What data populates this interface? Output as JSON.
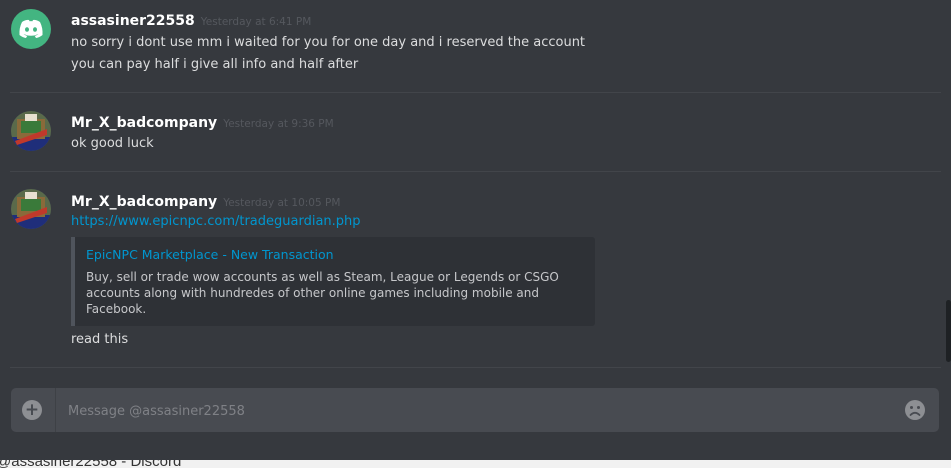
{
  "messages": [
    {
      "username": "assasiner22558",
      "timestamp": "Yesterday at 6:41 PM",
      "avatar_icon": "discord-logo-icon",
      "lines": [
        "no sorry i dont use mm i waited for you for one day and i reserved the account",
        "you can pay half i give all info and half after"
      ]
    },
    {
      "username": "Mr_X_badcompany",
      "timestamp": "Yesterday at 9:36 PM",
      "avatar_icon": "user-avatar",
      "lines": [
        "ok good luck"
      ]
    },
    {
      "username": "Mr_X_badcompany",
      "timestamp": "Yesterday at 10:05 PM",
      "avatar_icon": "user-avatar",
      "link": "https://www.epicnpc.com/tradeguardian.php",
      "embed": {
        "title": "EpicNPC Marketplace - New Transaction",
        "description": [
          "Buy, sell or trade wow accounts as well as Steam, League or Legends or CSGO",
          "accounts along with hundredes of other online games including mobile and",
          "Facebook."
        ]
      },
      "after_text": "read this"
    }
  ],
  "composer": {
    "placeholder": "Message @assasiner22558",
    "attach_icon": "plus-circle-icon",
    "emoji_icon": "sad-face-icon"
  },
  "window_title": "@assasiner22558 - Discord",
  "colors": {
    "background": "#36393e",
    "link": "#0096cf",
    "discord_green": "#43b581",
    "composer": "#484b51"
  }
}
